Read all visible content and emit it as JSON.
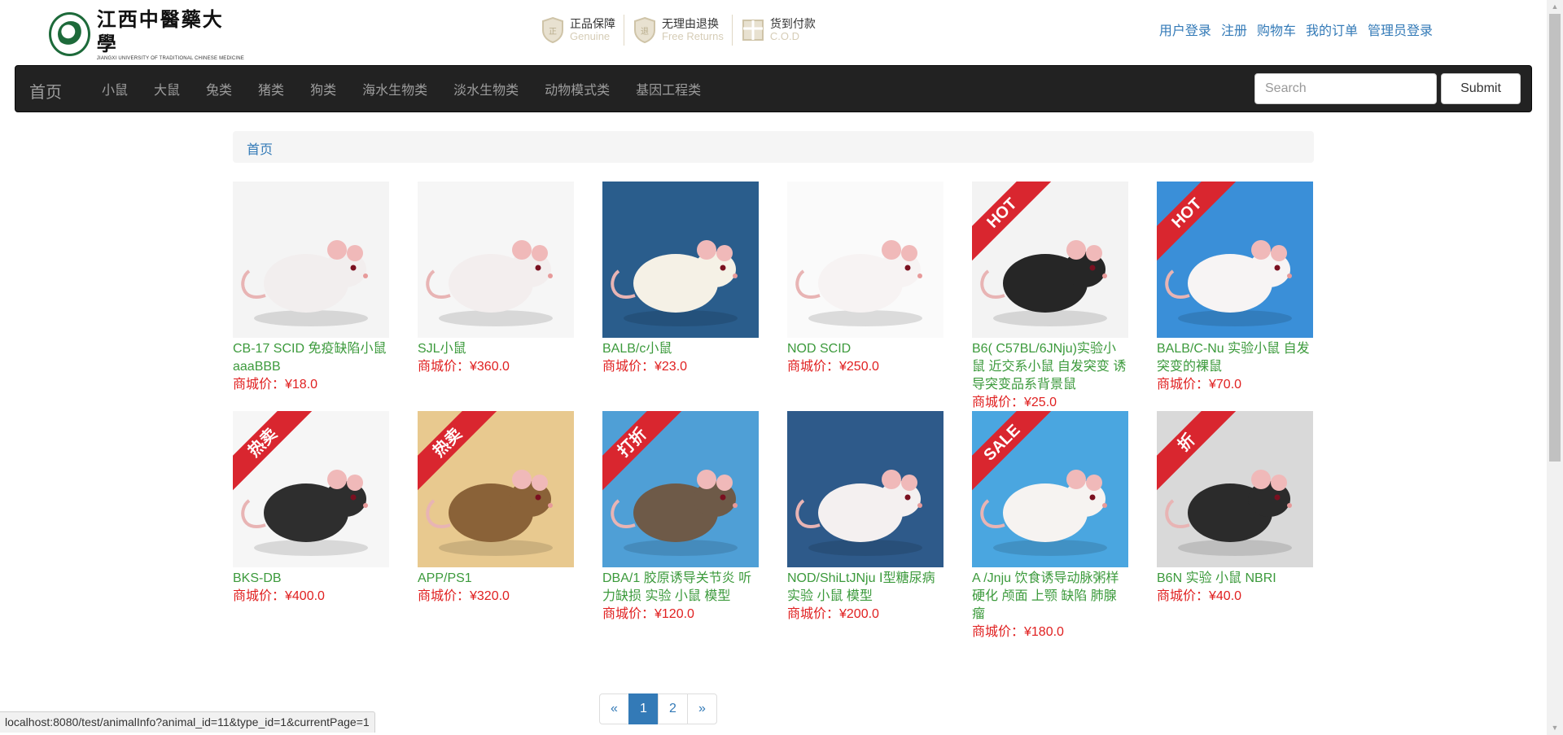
{
  "header": {
    "logo_cn": "江西中醫藥大學",
    "logo_en": "JIANGXI UNIVERSITY OF TRADITIONAL CHINESE MEDICINE",
    "guarantees": [
      {
        "cn": "正品保障",
        "en": "Genuine",
        "icon": "shield-icon"
      },
      {
        "cn": "无理由退换",
        "en": "Free Returns",
        "icon": "return-shield-icon"
      },
      {
        "cn": "货到付款",
        "en": "C.O.D",
        "icon": "package-icon"
      }
    ],
    "links": [
      "用户登录",
      "注册",
      "购物车",
      "我的订单",
      "管理员登录"
    ]
  },
  "navbar": {
    "brand": "首页",
    "items": [
      "小鼠",
      "大鼠",
      "兔类",
      "猪类",
      "狗类",
      "海水生物类",
      "淡水生物类",
      "动物模式类",
      "基因工程类"
    ],
    "search_placeholder": "Search",
    "submit_label": "Submit"
  },
  "breadcrumb": {
    "home": "首页"
  },
  "products": [
    {
      "name": "CB-17 SCID 免疫缺陷小鼠 aaaBBB",
      "price": "商城价：¥18.0",
      "bg": "#f4f4f4",
      "fur": "#f2eeee",
      "badge": ""
    },
    {
      "name": "SJL小鼠",
      "price": "商城价：¥360.0",
      "bg": "#f6f6f6",
      "fur": "#f3eeee",
      "badge": ""
    },
    {
      "name": "BALB/c小鼠",
      "price": "商城价：¥23.0",
      "bg": "#2a5d8c",
      "fur": "#f5f1e6",
      "badge": ""
    },
    {
      "name": "NOD SCID",
      "price": "商城价：¥250.0",
      "bg": "#fafafa",
      "fur": "#f7f3f3",
      "badge": ""
    },
    {
      "name": "B6( C57BL/6JNju)实验小鼠 近交系小鼠 自发突变 诱导突变品系背景鼠",
      "price": "商城价：¥25.0",
      "bg": "#f3f3f3",
      "fur": "#262626",
      "badge": "HOT"
    },
    {
      "name": "BALB/C-Nu 实验小鼠 自发突变的裸鼠",
      "price": "商城价：¥70.0",
      "bg": "#3a8fd8",
      "fur": "#f7f4f4",
      "badge": "HOT"
    },
    {
      "name": "BKS-DB",
      "price": "商城价：¥400.0",
      "bg": "#f6f6f6",
      "fur": "#2e2e2e",
      "badge": "热卖"
    },
    {
      "name": "APP/PS1",
      "price": "商城价：¥320.0",
      "bg": "#e8c98f",
      "fur": "#8a6238",
      "badge": "热卖"
    },
    {
      "name": "DBA/1 胶原诱导关节炎 听力缺损 实验 小鼠 模型",
      "price": "商城价：¥120.0",
      "bg": "#4f9fd6",
      "fur": "#6e5a48",
      "badge": "打折"
    },
    {
      "name": "NOD/ShiLtJNju Ⅰ型糖尿病 实验 小鼠 模型",
      "price": "商城价：¥200.0",
      "bg": "#2e5a8a",
      "fur": "#f4f0f0",
      "badge": ""
    },
    {
      "name": "A /Jnju 饮食诱导动脉粥样硬化 颅面 上颚 缺陷 肺腺瘤",
      "price": "商城价：¥180.0",
      "bg": "#4aa6e0",
      "fur": "#f6f3f1",
      "badge": "SALE"
    },
    {
      "name": "B6N 实验 小鼠 NBRI",
      "price": "商城价：¥40.0",
      "bg": "#d9d9d9",
      "fur": "#2b2b2b",
      "badge": "折"
    }
  ],
  "pagination": {
    "prev": "«",
    "pages": [
      "1",
      "2"
    ],
    "current": "1",
    "next": "»"
  },
  "status_bar": "localhost:8080/test/animalInfo?animal_id=11&type_id=1&currentPage=1",
  "colors": {
    "accent": "#337ab7",
    "product_name": "#3c9a3c",
    "price": "#e02020",
    "navbar": "#222222",
    "ribbon": "#d9262f"
  }
}
